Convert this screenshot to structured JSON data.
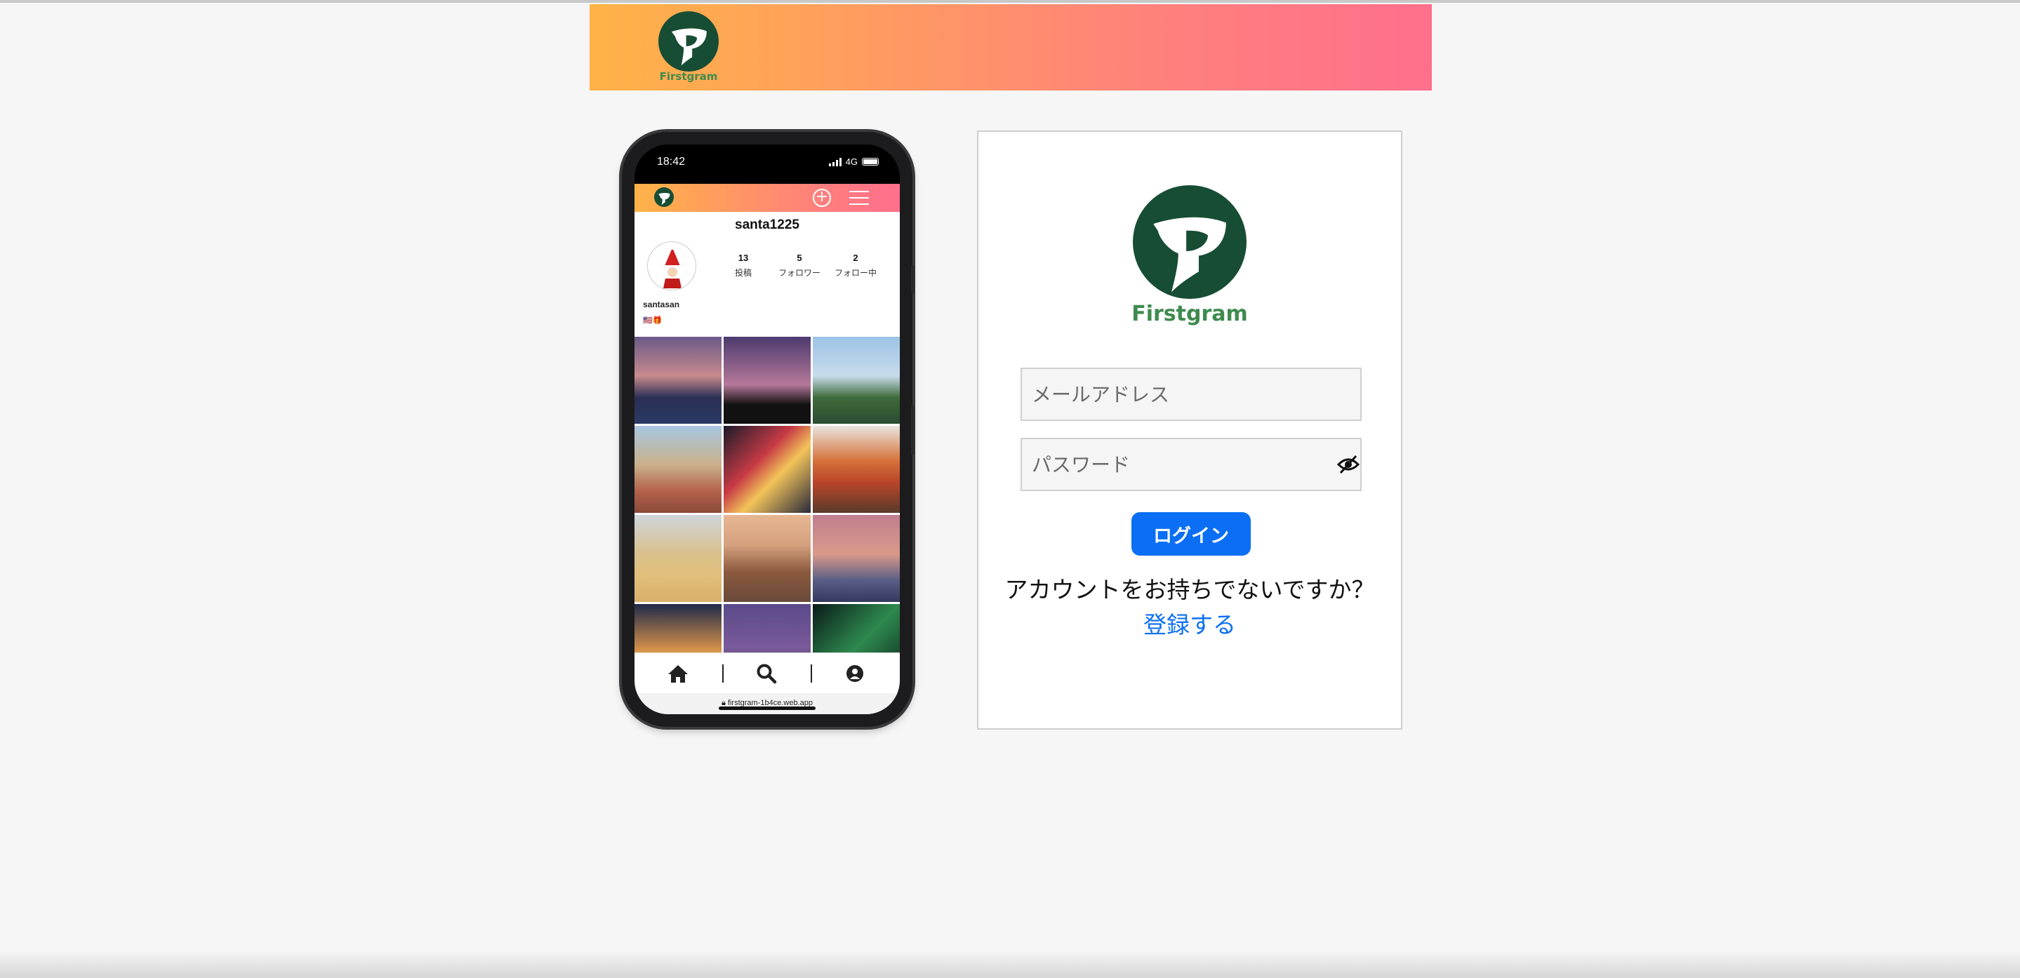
{
  "brand": {
    "name": "Firstgram",
    "logo_color": "#174d34",
    "text_color": "#3f8b4f"
  },
  "colors": {
    "accent": "#0a6ff5",
    "banner_start": "#ffb347",
    "banner_end": "#ff6f8c"
  },
  "phone_preview": {
    "status": {
      "time": "18:42",
      "network": "4G"
    },
    "profile": {
      "username": "santa1225",
      "display_name": "santasan",
      "bio": "🇺🇸🎁",
      "stats": [
        {
          "count": "13",
          "label": "投稿"
        },
        {
          "count": "5",
          "label": "フォロワー"
        },
        {
          "count": "2",
          "label": "フォロー中"
        }
      ]
    },
    "tabs": [
      "home-icon",
      "search-icon",
      "user-icon"
    ],
    "url": "firstgram-1b4ce.web.app"
  },
  "login": {
    "email_placeholder": "メールアドレス",
    "password_placeholder": "パスワード",
    "login_button": "ログイン",
    "no_account_text": "アカウントをお持ちでないですか？",
    "register_link": "登録する"
  }
}
